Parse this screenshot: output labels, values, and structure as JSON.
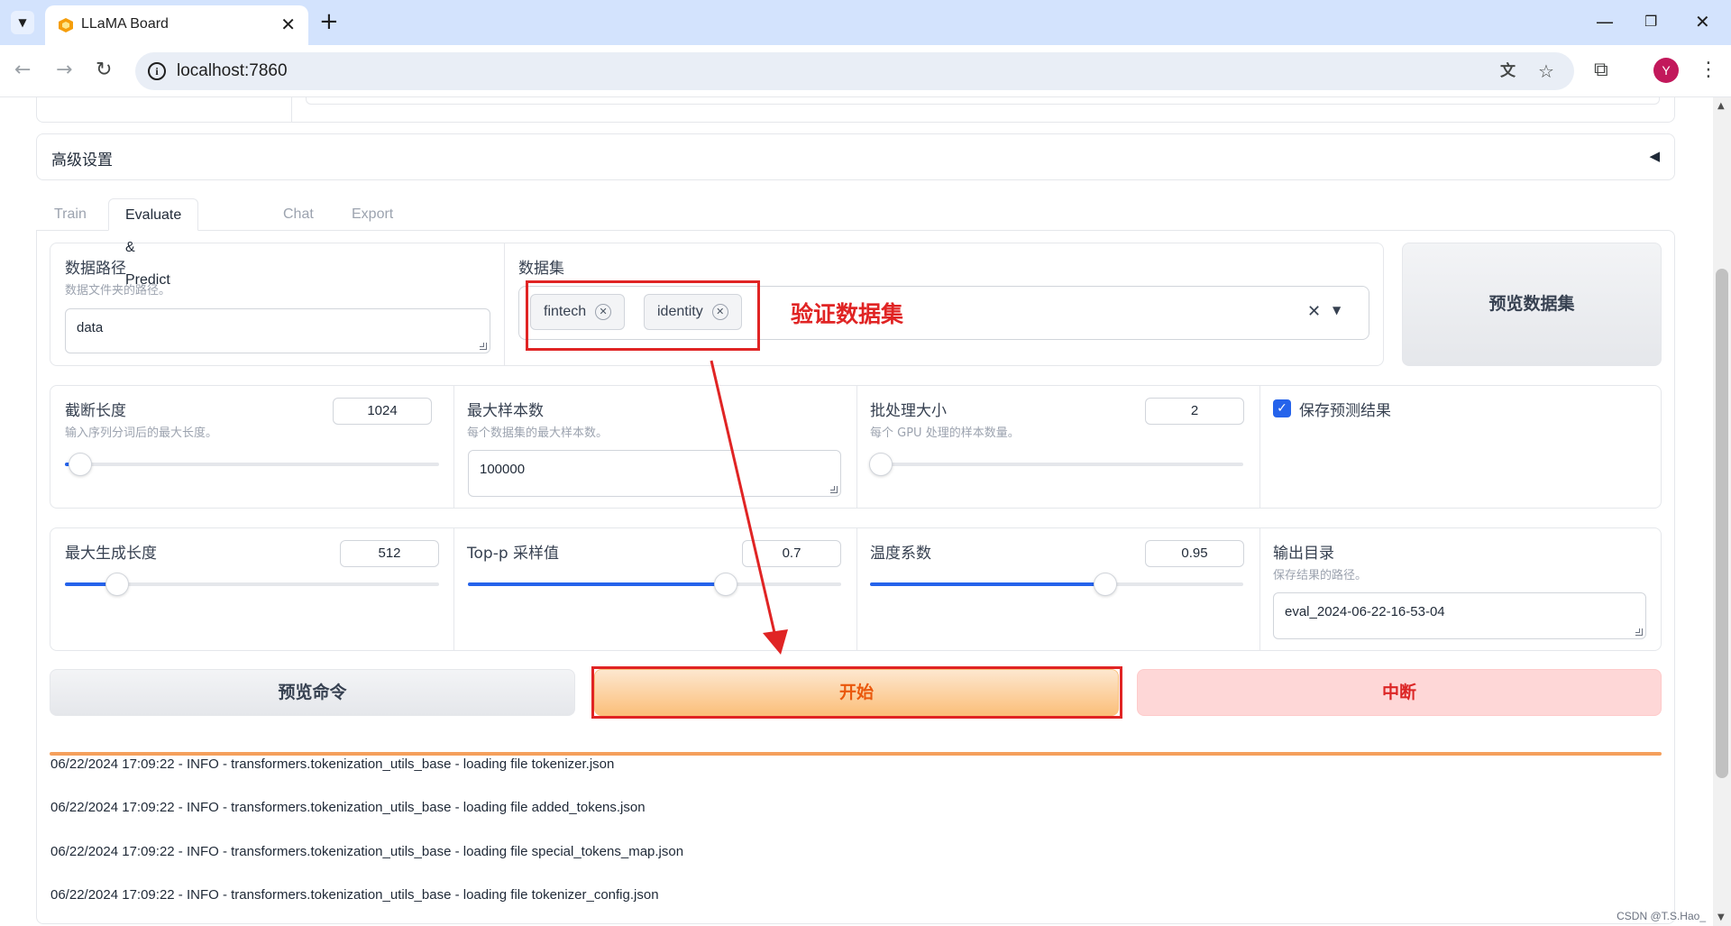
{
  "browser": {
    "tab_title": "LLaMA Board",
    "url": "localhost:7860",
    "profile_initial": "Y"
  },
  "prev_panel": {},
  "advanced": {
    "title": "高级设置"
  },
  "tabs": [
    "Train",
    "Evaluate & Predict",
    "Chat",
    "Export"
  ],
  "dataset_dir": {
    "label": "数据路径",
    "info": "数据文件夹的路径。",
    "value": "data"
  },
  "dataset": {
    "label": "数据集",
    "chips": [
      "fintech",
      "identity"
    ],
    "annotation": "验证数据集"
  },
  "preview_dataset_button": "预览数据集",
  "cutoff_len": {
    "label": "截断长度",
    "info": "输入序列分词后的最大长度。",
    "value": "1024",
    "fraction": 0.04
  },
  "max_samples": {
    "label": "最大样本数",
    "info": "每个数据集的最大样本数。",
    "value": "100000"
  },
  "batch_size": {
    "label": "批处理大小",
    "info": "每个 GPU 处理的样本数量。",
    "value": "2",
    "fraction": 0.03
  },
  "predict": {
    "label": "保存预测结果",
    "checked": true
  },
  "max_new_tokens": {
    "label": "最大生成长度",
    "value": "512",
    "fraction": 0.14
  },
  "top_p": {
    "label": "Top-p 采样值",
    "value": "0.7",
    "fraction": 0.69
  },
  "temperature": {
    "label": "温度系数",
    "value": "0.95",
    "fraction": 0.63
  },
  "output_dir": {
    "label": "输出目录",
    "info": "保存结果的路径。",
    "value": "eval_2024-06-22-16-53-04"
  },
  "buttons": {
    "preview_cmd": "预览命令",
    "start": "开始",
    "stop": "中断"
  },
  "logs": [
    "06/22/2024 17:09:22 - INFO - transformers.tokenization_utils_base - loading file tokenizer.json",
    "06/22/2024 17:09:22 - INFO - transformers.tokenization_utils_base - loading file added_tokens.json",
    "06/22/2024 17:09:22 - INFO - transformers.tokenization_utils_base - loading file special_tokens_map.json",
    "06/22/2024 17:09:22 - INFO - transformers.tokenization_utils_base - loading file tokenizer_config.json"
  ],
  "watermark": "CSDN @T.S.Hao_",
  "colors": {
    "accent": "#2563eb",
    "annotation_red": "#e02424",
    "start_gradient_top": "#fde7cf",
    "start_gradient_bottom": "#fbbf7a",
    "start_text": "#ea580c",
    "stop_bg": "#fed7d7",
    "stop_text": "#dc2626",
    "progress_orange": "#f5a05c"
  }
}
